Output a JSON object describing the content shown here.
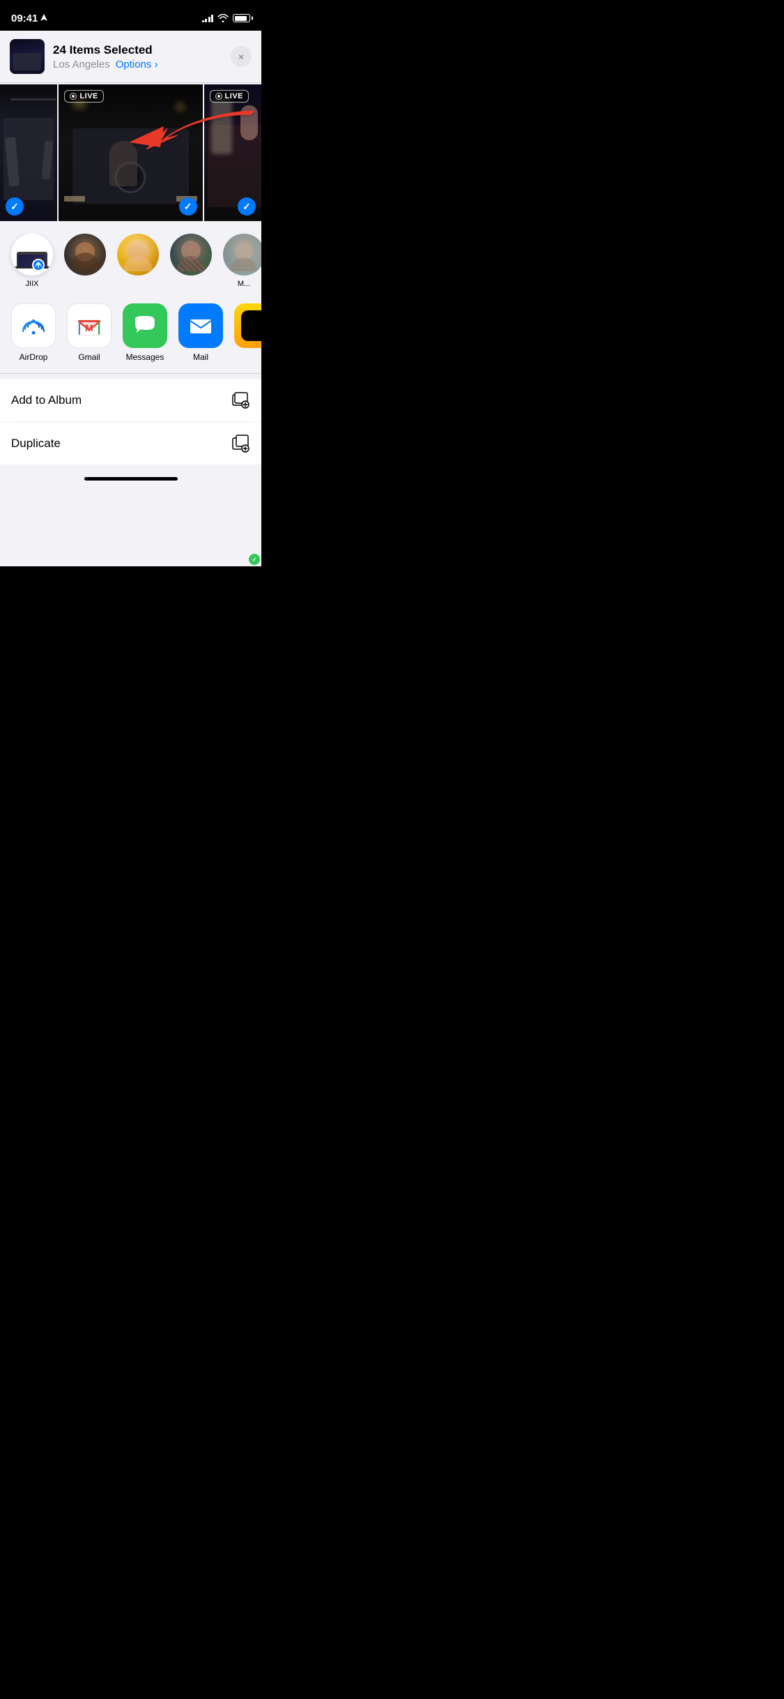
{
  "status_bar": {
    "time": "09:41",
    "location_arrow": "▶",
    "signal_bars": 4,
    "wifi": true,
    "battery": 85
  },
  "share_header": {
    "items_selected": "24 Items Selected",
    "location": "Los Angeles",
    "options_label": "Options",
    "options_chevron": "›",
    "close_button": "×"
  },
  "photos": {
    "live_badge": "LIVE",
    "check_icon": "✓"
  },
  "contacts": [
    {
      "name": "JIIX",
      "type": "airdrop"
    },
    {
      "name": "",
      "type": "person"
    },
    {
      "name": "",
      "type": "person"
    },
    {
      "name": "",
      "type": "person"
    },
    {
      "name": "M...",
      "type": "person_partial"
    }
  ],
  "apps": [
    {
      "label": "AirDrop",
      "type": "airdrop"
    },
    {
      "label": "Gmail",
      "type": "gmail"
    },
    {
      "label": "Messages",
      "type": "messages"
    },
    {
      "label": "Mail",
      "type": "mail"
    },
    {
      "label": "",
      "type": "partial"
    }
  ],
  "actions": [
    {
      "label": "Add to Album",
      "icon": "album"
    },
    {
      "label": "Duplicate",
      "icon": "duplicate"
    }
  ],
  "colors": {
    "blue": "#007aff",
    "green": "#34c759",
    "red": "#e8392a",
    "gray_bg": "#f2f2f7",
    "black": "#000000",
    "white": "#ffffff"
  }
}
